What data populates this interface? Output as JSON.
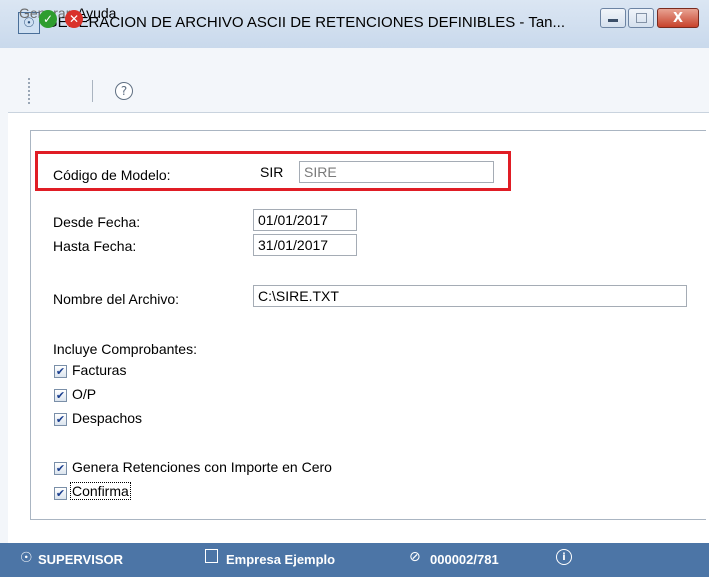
{
  "window": {
    "title": "GENERACION DE ARCHIVO ASCII DE RETENCIONES DEFINIBLES - Tan...",
    "app_icon": "tango-app-icon",
    "controls": {
      "minimize": "▭",
      "maximize": "▢",
      "close": "X"
    }
  },
  "menu": {
    "items": [
      {
        "label": "Generar"
      },
      {
        "label": "Ayuda"
      }
    ]
  },
  "toolbar": {
    "ok_icon": "✓",
    "cancel_icon": "✕",
    "help_icon": "?"
  },
  "form": {
    "codigo_label": "Código de Modelo:",
    "codigo_value": "SIR",
    "codigo_desc": "SIRE",
    "desde_label": "Desde Fecha:",
    "desde_value": "01/01/2017",
    "hasta_label": "Hasta Fecha:",
    "hasta_value": "31/01/2017",
    "archivo_label": "Nombre del Archivo:",
    "archivo_value": "C:\\SIRE.TXT",
    "comprobantes_label": "Incluye Comprobantes:",
    "checkboxes": [
      {
        "label": "Facturas",
        "checked": true
      },
      {
        "label": "O/P",
        "checked": true
      },
      {
        "label": "Despachos",
        "checked": true
      }
    ],
    "genera_label": "Genera Retenciones con Importe en Cero",
    "genera_checked": true,
    "confirma_label": "Confirma",
    "confirma_checked": true
  },
  "colors": {
    "highlight_border": "#e01d25",
    "status_bar": "#4c75a6",
    "ok_green": "#2e9d2e",
    "cancel_red": "#d9312a"
  },
  "status": {
    "user": "SUPERVISOR",
    "company": "Empresa Ejemplo",
    "code": "000002/781"
  }
}
